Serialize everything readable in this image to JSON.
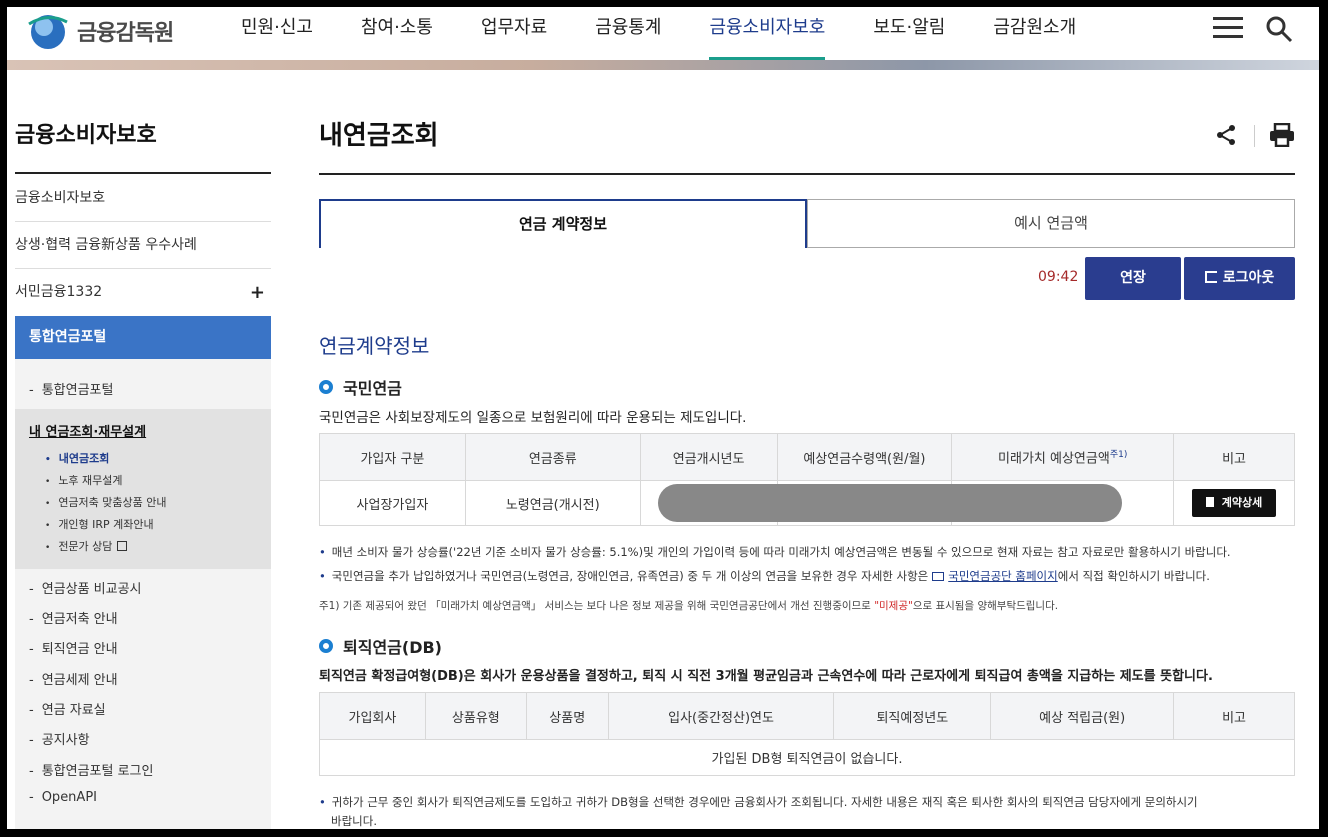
{
  "header": {
    "logo_text": "금융감독원",
    "nav": [
      "민원·신고",
      "참여·소통",
      "업무자료",
      "금융통계",
      "금융소비자보호",
      "보도·알림",
      "금감원소개"
    ],
    "active_nav_index": 4
  },
  "sidebar": {
    "title": "금융소비자보호",
    "links": [
      "금융소비자보호",
      "상생·협력 금융新상품 우수사례",
      "서민금융1332"
    ],
    "expand_symbol": "+",
    "active": "통합연금포털",
    "sub": {
      "first": "통합연금포털",
      "selected": "내 연금조회·재무설계",
      "third": [
        "내연금조회",
        "노후 재무설계",
        "연금저축 맞춤상품 안내",
        "개인형 IRP 계좌안내",
        "전문가 상담"
      ],
      "rest": [
        "연금상품 비교공시",
        "연금저축 안내",
        "퇴직연금 안내",
        "연금세제 안내",
        "연금 자료실",
        "공지사항",
        "통합연금포털 로그인",
        "OpenAPI"
      ]
    }
  },
  "main": {
    "title": "내연금조회",
    "tabs": [
      "연금 계약정보",
      "예시 연금액"
    ],
    "timer": "09:42",
    "extend_label": "연장",
    "logout_label": "로그아웃",
    "section_title": "연금계약정보",
    "national": {
      "heading": "국민연금",
      "desc": "국민연금은 사회보장제도의 일종으로 보험원리에 따라 운용되는 제도입니다.",
      "columns": [
        "가입자 구분",
        "연금종류",
        "연금개시년도",
        "예상연금수령액(원/월)",
        "미래가치 예상연금액",
        "비고"
      ],
      "footnote_mark": "주1)",
      "row": [
        "사업장가입자",
        "노령연금(개시전)"
      ],
      "detail_button": "계약상세",
      "bullet1": "매년 소비자 물가 상승률('22년 기준 소비자 물가 상승률: 5.1%)및 개인의 가입이력 등에 따라 미래가치 예상연금액은 변동될 수 있으므로 현재 자료는 참고 자료로만 활용하시기 바랍니다.",
      "bullet2_pre": "국민연금을 추가 납입하였거나 국민연금(노령연금, 장애인연금, 유족연금) 중 두 개 이상의 연금을 보유한 경우 자세한 사항은",
      "bullet2_link": "국민연금공단 홈페이지",
      "bullet2_post": "에서 직접 확인하시기 바랍니다.",
      "note_pre": "주1) 기존 제공되어 왔던 「미래가치 예상연금액」 서비스는 보다 나은 정보 제공을 위해 국민연금공단에서 개선 진행중이므로",
      "note_red": "\"미제공\"",
      "note_post": "으로 표시됨을 양해부탁드립니다."
    },
    "retirement": {
      "heading": "퇴직연금(DB)",
      "desc": "퇴직연금 확정급여형(DB)은 회사가 운용상품을 결정하고, 퇴직 시 직전 3개월 평균임금과 근속연수에 따라 근로자에게 퇴직급여 총액을 지급하는 제도를 뜻합니다.",
      "columns": [
        "가입회사",
        "상품유형",
        "상품명",
        "입사(중간정산)연도",
        "퇴직예정년도",
        "예상 적립금(원)",
        "비고"
      ],
      "empty": "가입된 DB형 퇴직연금이 없습니다.",
      "bullet_line1": "귀하가 근무 중인 회사가 퇴직연금제도를 도입하고 귀하가 DB형을 선택한 경우에만 금융회사가 조회됩니다. 자세한 내용은 재직 혹은 퇴사한 회사의 퇴직연금 담당자에게 문의하시기",
      "bullet_line2": "바랍니다."
    }
  }
}
